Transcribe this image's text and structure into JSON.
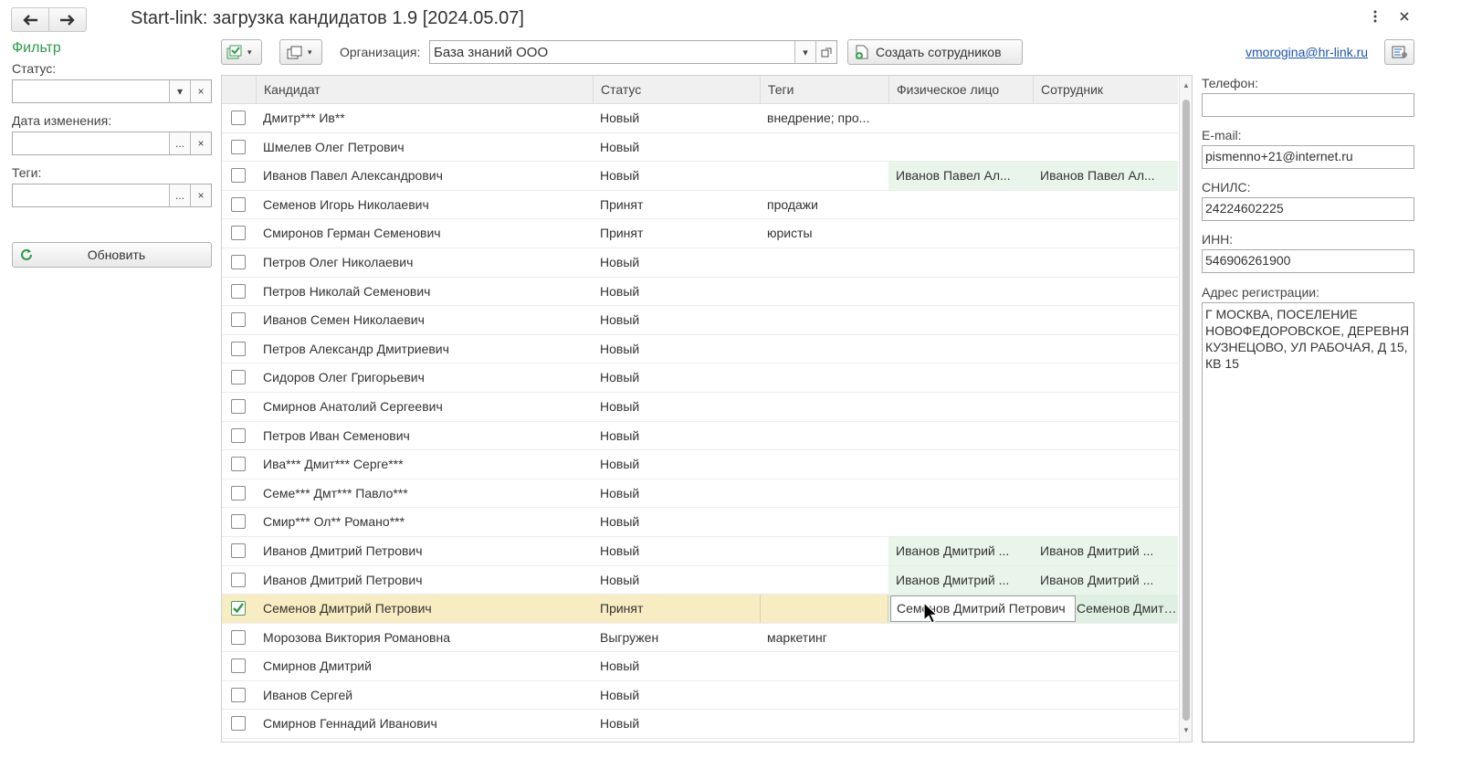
{
  "window": {
    "title": "Start-link: загрузка кандидатов 1.9 [2024.05.07]"
  },
  "filter": {
    "heading": "Фильтр",
    "status_label": "Статус:",
    "status_value": "",
    "date_label": "Дата изменения:",
    "date_value": "",
    "tags_label": "Теги:",
    "tags_value": "",
    "refresh_label": "Обновить",
    "select_glyph": "▾",
    "clear_glyph": "×",
    "more_glyph": "..."
  },
  "toolbar": {
    "org_label": "Организация:",
    "org_value": "База знаний ООО",
    "create_label": "Создать сотрудников",
    "user_email": "vmorogina@hr-link.ru",
    "dropdown_glyph": "▾"
  },
  "table": {
    "columns": [
      "Кандидат",
      "Статус",
      "Теги",
      "Физическое лицо",
      "Сотрудник"
    ],
    "rows": [
      {
        "checked": false,
        "candidate": "Дмитр*** Ив**",
        "status": "Новый",
        "tags": "внедрение; про...",
        "person": "",
        "employee": ""
      },
      {
        "checked": false,
        "candidate": "Шмелев Олег Петрович",
        "status": "Новый",
        "tags": "",
        "person": "",
        "employee": ""
      },
      {
        "checked": false,
        "candidate": "Иванов Павел Александрович",
        "status": "Новый",
        "tags": "",
        "person": "Иванов Павел Ал...",
        "employee": "Иванов Павел Ал..."
      },
      {
        "checked": false,
        "candidate": "Семенов Игорь Николаевич",
        "status": "Принят",
        "tags": "продажи",
        "person": "",
        "employee": ""
      },
      {
        "checked": false,
        "candidate": "Смиронов Герман Семенович",
        "status": "Принят",
        "tags": "юристы",
        "person": "",
        "employee": ""
      },
      {
        "checked": false,
        "candidate": "Петров Олег Николаевич",
        "status": "Новый",
        "tags": "",
        "person": "",
        "employee": ""
      },
      {
        "checked": false,
        "candidate": "Петров Николай Семенович",
        "status": "Новый",
        "tags": "",
        "person": "",
        "employee": ""
      },
      {
        "checked": false,
        "candidate": "Иванов Семен Николаевич",
        "status": "Новый",
        "tags": "",
        "person": "",
        "employee": ""
      },
      {
        "checked": false,
        "candidate": "Петров Александр Дмитриевич",
        "status": "Новый",
        "tags": "",
        "person": "",
        "employee": ""
      },
      {
        "checked": false,
        "candidate": "Сидоров Олег Григорьевич",
        "status": "Новый",
        "tags": "",
        "person": "",
        "employee": ""
      },
      {
        "checked": false,
        "candidate": "Смирнов Анатолий Сергеевич",
        "status": "Новый",
        "tags": "",
        "person": "",
        "employee": ""
      },
      {
        "checked": false,
        "candidate": "Петров Иван Семенович",
        "status": "Новый",
        "tags": "",
        "person": "",
        "employee": ""
      },
      {
        "checked": false,
        "candidate": "Ива*** Дмит*** Серге***",
        "status": "Новый",
        "tags": "",
        "person": "",
        "employee": ""
      },
      {
        "checked": false,
        "candidate": "Семе*** Дмт*** Павло***",
        "status": "Новый",
        "tags": "",
        "person": "",
        "employee": ""
      },
      {
        "checked": false,
        "candidate": "Смир*** Ол** Романо***",
        "status": "Новый",
        "tags": "",
        "person": "",
        "employee": ""
      },
      {
        "checked": false,
        "candidate": "Иванов Дмитрий Петрович",
        "status": "Новый",
        "tags": "",
        "person": "Иванов Дмитрий ...",
        "employee": "Иванов Дмитрий ..."
      },
      {
        "checked": false,
        "candidate": "Иванов Дмитрий Петрович",
        "status": "Новый",
        "tags": "",
        "person": "Иванов Дмитрий ...",
        "employee": "Иванов Дмитрий ..."
      },
      {
        "checked": true,
        "selected": true,
        "candidate": "Семенов Дмитрий Петрович",
        "status": "Принят",
        "tags": "",
        "person": "Семенов Дмитрий Петрович",
        "employee": "Семенов Дмитрий..."
      },
      {
        "checked": false,
        "candidate": "Морозова Виктория Романовна",
        "status": "Выгружен",
        "tags": "маркетинг",
        "person": "",
        "employee": ""
      },
      {
        "checked": false,
        "candidate": "Смирнов Дмитрий",
        "status": "Новый",
        "tags": "",
        "person": "",
        "employee": ""
      },
      {
        "checked": false,
        "candidate": "Иванов Сергей",
        "status": "Новый",
        "tags": "",
        "person": "",
        "employee": ""
      },
      {
        "checked": false,
        "candidate": "Смирнов Геннадий Иванович",
        "status": "Новый",
        "tags": "",
        "person": "",
        "employee": ""
      }
    ]
  },
  "details": {
    "phone_label": "Телефон:",
    "phone_value": "",
    "email_label": "E-mail:",
    "email_value": "pismenno+21@internet.ru",
    "snils_label": "СНИЛС:",
    "snils_value": "24224602225",
    "inn_label": "ИНН:",
    "inn_value": "546906261900",
    "address_label": "Адрес регистрации:",
    "address_value": "Г МОСКВА, ПОСЕЛЕНИЕ НОВОФЕДОРОВСКОЕ, ДЕРЕВНЯ КУЗНЕЦОВО, УЛ РАБОЧАЯ, Д 15, КВ 15"
  },
  "colors": {
    "accent_green": "#2f9a4c",
    "selected_row": "#f8ecc2",
    "linked_cell": "#e9f5ea",
    "link_blue": "#1a56b0"
  },
  "icons": [
    "arrow-left-icon",
    "arrow-right-icon",
    "more-vertical-icon",
    "close-icon",
    "check-all-icon",
    "copy-icon",
    "create-employee-icon",
    "settings-panel-icon",
    "refresh-icon",
    "cursor-icon"
  ]
}
